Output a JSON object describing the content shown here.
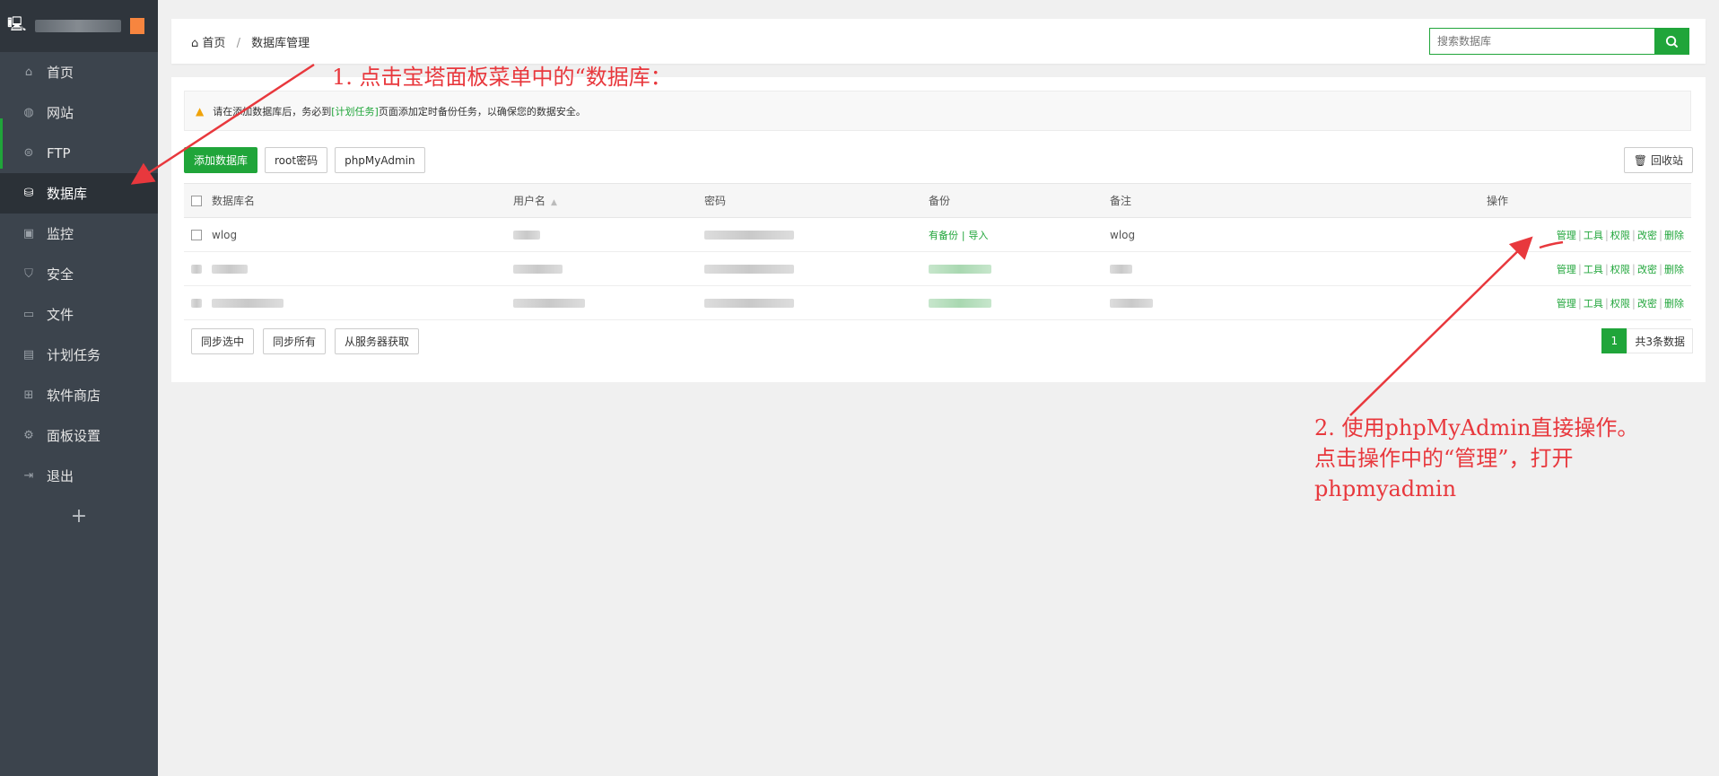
{
  "sidebar": {
    "items": [
      {
        "label": "首页",
        "icon": "home-icon"
      },
      {
        "label": "网站",
        "icon": "globe-icon"
      },
      {
        "label": "FTP",
        "icon": "ftp-icon"
      },
      {
        "label": "数据库",
        "icon": "database-icon"
      },
      {
        "label": "监控",
        "icon": "monitor-icon"
      },
      {
        "label": "安全",
        "icon": "shield-icon"
      },
      {
        "label": "文件",
        "icon": "folder-icon"
      },
      {
        "label": "计划任务",
        "icon": "calendar-icon"
      },
      {
        "label": "软件商店",
        "icon": "grid-icon"
      },
      {
        "label": "面板设置",
        "icon": "gear-icon"
      },
      {
        "label": "退出",
        "icon": "logout-icon"
      }
    ],
    "active": "数据库",
    "add_label": "+"
  },
  "breadcrumb": {
    "home": "首页",
    "sep": "/",
    "current": "数据库管理"
  },
  "search": {
    "placeholder": "搜索数据库"
  },
  "notice": {
    "prefix": "请在添加数据库后，务必到",
    "link": "[计划任务]",
    "suffix": "页面添加定时备份任务，以确保您的数据安全。"
  },
  "toolbar": {
    "add": "添加数据库",
    "root": "root密码",
    "pma": "phpMyAdmin",
    "recycle": "回收站"
  },
  "table": {
    "headers": {
      "name": "数据库名",
      "user": "用户名",
      "password": "密码",
      "backup": "备份",
      "note": "备注",
      "ops": "操作"
    },
    "rows": [
      {
        "name": "wlog",
        "backup_have": "有备份",
        "backup_import": "导入",
        "note": "wlog"
      }
    ],
    "ops": {
      "manage": "管理",
      "tools": "工具",
      "perm": "权限",
      "pwd": "改密",
      "del": "删除",
      "bar": "|"
    }
  },
  "footer": {
    "sync_sel": "同步选中",
    "sync_all": "同步所有",
    "fetch": "从服务器获取",
    "page": "1",
    "total": "共3条数据"
  },
  "annotations": {
    "step1": "1. 点击宝塔面板菜单中的“数据库：",
    "step2_line1": "2. 使用phpMyAdmin直接操作。",
    "step2_line2": "点击操作中的“管理”，打开",
    "step2_line3": "phpmyadmin"
  },
  "colors": {
    "accent": "#20a53a",
    "sidebar": "#3c444d",
    "annotation": "#e8383d"
  }
}
